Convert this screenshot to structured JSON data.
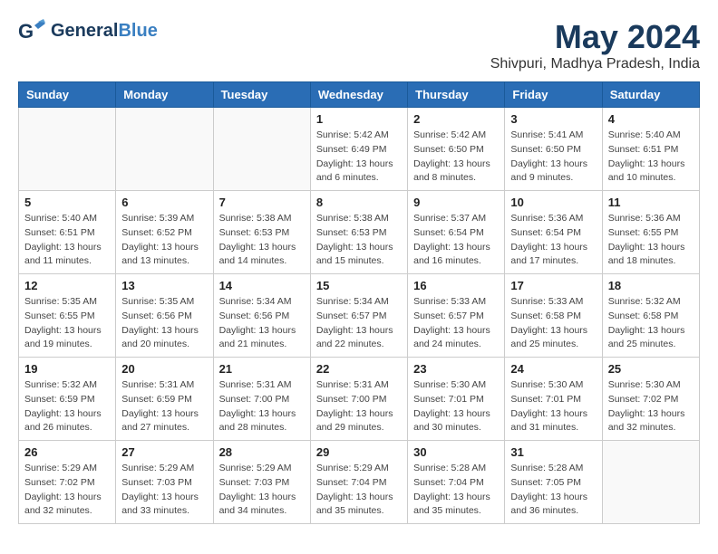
{
  "header": {
    "logo_general": "General",
    "logo_blue": "Blue",
    "month": "May 2024",
    "location": "Shivpuri, Madhya Pradesh, India"
  },
  "weekdays": [
    "Sunday",
    "Monday",
    "Tuesday",
    "Wednesday",
    "Thursday",
    "Friday",
    "Saturday"
  ],
  "weeks": [
    [
      {
        "day": "",
        "info": ""
      },
      {
        "day": "",
        "info": ""
      },
      {
        "day": "",
        "info": ""
      },
      {
        "day": "1",
        "info": "Sunrise: 5:42 AM\nSunset: 6:49 PM\nDaylight: 13 hours\nand 6 minutes."
      },
      {
        "day": "2",
        "info": "Sunrise: 5:42 AM\nSunset: 6:50 PM\nDaylight: 13 hours\nand 8 minutes."
      },
      {
        "day": "3",
        "info": "Sunrise: 5:41 AM\nSunset: 6:50 PM\nDaylight: 13 hours\nand 9 minutes."
      },
      {
        "day": "4",
        "info": "Sunrise: 5:40 AM\nSunset: 6:51 PM\nDaylight: 13 hours\nand 10 minutes."
      }
    ],
    [
      {
        "day": "5",
        "info": "Sunrise: 5:40 AM\nSunset: 6:51 PM\nDaylight: 13 hours\nand 11 minutes."
      },
      {
        "day": "6",
        "info": "Sunrise: 5:39 AM\nSunset: 6:52 PM\nDaylight: 13 hours\nand 13 minutes."
      },
      {
        "day": "7",
        "info": "Sunrise: 5:38 AM\nSunset: 6:53 PM\nDaylight: 13 hours\nand 14 minutes."
      },
      {
        "day": "8",
        "info": "Sunrise: 5:38 AM\nSunset: 6:53 PM\nDaylight: 13 hours\nand 15 minutes."
      },
      {
        "day": "9",
        "info": "Sunrise: 5:37 AM\nSunset: 6:54 PM\nDaylight: 13 hours\nand 16 minutes."
      },
      {
        "day": "10",
        "info": "Sunrise: 5:36 AM\nSunset: 6:54 PM\nDaylight: 13 hours\nand 17 minutes."
      },
      {
        "day": "11",
        "info": "Sunrise: 5:36 AM\nSunset: 6:55 PM\nDaylight: 13 hours\nand 18 minutes."
      }
    ],
    [
      {
        "day": "12",
        "info": "Sunrise: 5:35 AM\nSunset: 6:55 PM\nDaylight: 13 hours\nand 19 minutes."
      },
      {
        "day": "13",
        "info": "Sunrise: 5:35 AM\nSunset: 6:56 PM\nDaylight: 13 hours\nand 20 minutes."
      },
      {
        "day": "14",
        "info": "Sunrise: 5:34 AM\nSunset: 6:56 PM\nDaylight: 13 hours\nand 21 minutes."
      },
      {
        "day": "15",
        "info": "Sunrise: 5:34 AM\nSunset: 6:57 PM\nDaylight: 13 hours\nand 22 minutes."
      },
      {
        "day": "16",
        "info": "Sunrise: 5:33 AM\nSunset: 6:57 PM\nDaylight: 13 hours\nand 24 minutes."
      },
      {
        "day": "17",
        "info": "Sunrise: 5:33 AM\nSunset: 6:58 PM\nDaylight: 13 hours\nand 25 minutes."
      },
      {
        "day": "18",
        "info": "Sunrise: 5:32 AM\nSunset: 6:58 PM\nDaylight: 13 hours\nand 25 minutes."
      }
    ],
    [
      {
        "day": "19",
        "info": "Sunrise: 5:32 AM\nSunset: 6:59 PM\nDaylight: 13 hours\nand 26 minutes."
      },
      {
        "day": "20",
        "info": "Sunrise: 5:31 AM\nSunset: 6:59 PM\nDaylight: 13 hours\nand 27 minutes."
      },
      {
        "day": "21",
        "info": "Sunrise: 5:31 AM\nSunset: 7:00 PM\nDaylight: 13 hours\nand 28 minutes."
      },
      {
        "day": "22",
        "info": "Sunrise: 5:31 AM\nSunset: 7:00 PM\nDaylight: 13 hours\nand 29 minutes."
      },
      {
        "day": "23",
        "info": "Sunrise: 5:30 AM\nSunset: 7:01 PM\nDaylight: 13 hours\nand 30 minutes."
      },
      {
        "day": "24",
        "info": "Sunrise: 5:30 AM\nSunset: 7:01 PM\nDaylight: 13 hours\nand 31 minutes."
      },
      {
        "day": "25",
        "info": "Sunrise: 5:30 AM\nSunset: 7:02 PM\nDaylight: 13 hours\nand 32 minutes."
      }
    ],
    [
      {
        "day": "26",
        "info": "Sunrise: 5:29 AM\nSunset: 7:02 PM\nDaylight: 13 hours\nand 32 minutes."
      },
      {
        "day": "27",
        "info": "Sunrise: 5:29 AM\nSunset: 7:03 PM\nDaylight: 13 hours\nand 33 minutes."
      },
      {
        "day": "28",
        "info": "Sunrise: 5:29 AM\nSunset: 7:03 PM\nDaylight: 13 hours\nand 34 minutes."
      },
      {
        "day": "29",
        "info": "Sunrise: 5:29 AM\nSunset: 7:04 PM\nDaylight: 13 hours\nand 35 minutes."
      },
      {
        "day": "30",
        "info": "Sunrise: 5:28 AM\nSunset: 7:04 PM\nDaylight: 13 hours\nand 35 minutes."
      },
      {
        "day": "31",
        "info": "Sunrise: 5:28 AM\nSunset: 7:05 PM\nDaylight: 13 hours\nand 36 minutes."
      },
      {
        "day": "",
        "info": ""
      }
    ]
  ]
}
